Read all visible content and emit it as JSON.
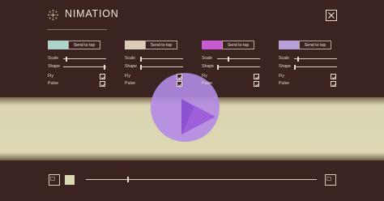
{
  "header": {
    "title": "NIMATION",
    "logo_icon": "snowflake-dots-icon",
    "close_icon": "close-icon"
  },
  "controls": [
    {
      "swatch_color": "#aed3c8",
      "send_label": "Send to top",
      "scale_label": "Scale",
      "shape_label": "Shape",
      "fly_label": "Fly",
      "pulse_label": "Pulse",
      "scale_value": 0.06,
      "shape_value": 0.95,
      "fly_checked": true,
      "pulse_checked": true
    },
    {
      "swatch_color": "#dbcbb7",
      "send_label": "Send to top",
      "scale_label": "Scale",
      "shape_label": "Shape",
      "fly_label": "Fly",
      "pulse_label": "Pulse",
      "scale_value": 0.0,
      "shape_value": 0.0,
      "fly_checked": true,
      "pulse_checked": true
    },
    {
      "swatch_color": "#c85bcf",
      "send_label": "Send to top",
      "scale_label": "Scale",
      "shape_label": "Shape",
      "fly_label": "Fly",
      "pulse_label": "Pulse",
      "scale_value": 0.25,
      "shape_value": 0.0,
      "fly_checked": true,
      "pulse_checked": true
    },
    {
      "swatch_color": "#b89fd6",
      "send_label": "Send to top",
      "scale_label": "Scale",
      "shape_label": "Shape",
      "fly_label": "Fly",
      "pulse_label": "Pulse",
      "scale_value": 0.08,
      "shape_value": 0.0,
      "fly_checked": true,
      "pulse_checked": true
    }
  ],
  "stage": {
    "band_color": "#dcd8b3",
    "disk_color": "#b48be4",
    "play_color": "#9a55d9"
  },
  "bottom": {
    "left_button_icon": "broken-image-icon",
    "swatch_color": "#dcd8b3",
    "timeline_value": 0.18,
    "right_button_icon": "broken-image-icon"
  }
}
